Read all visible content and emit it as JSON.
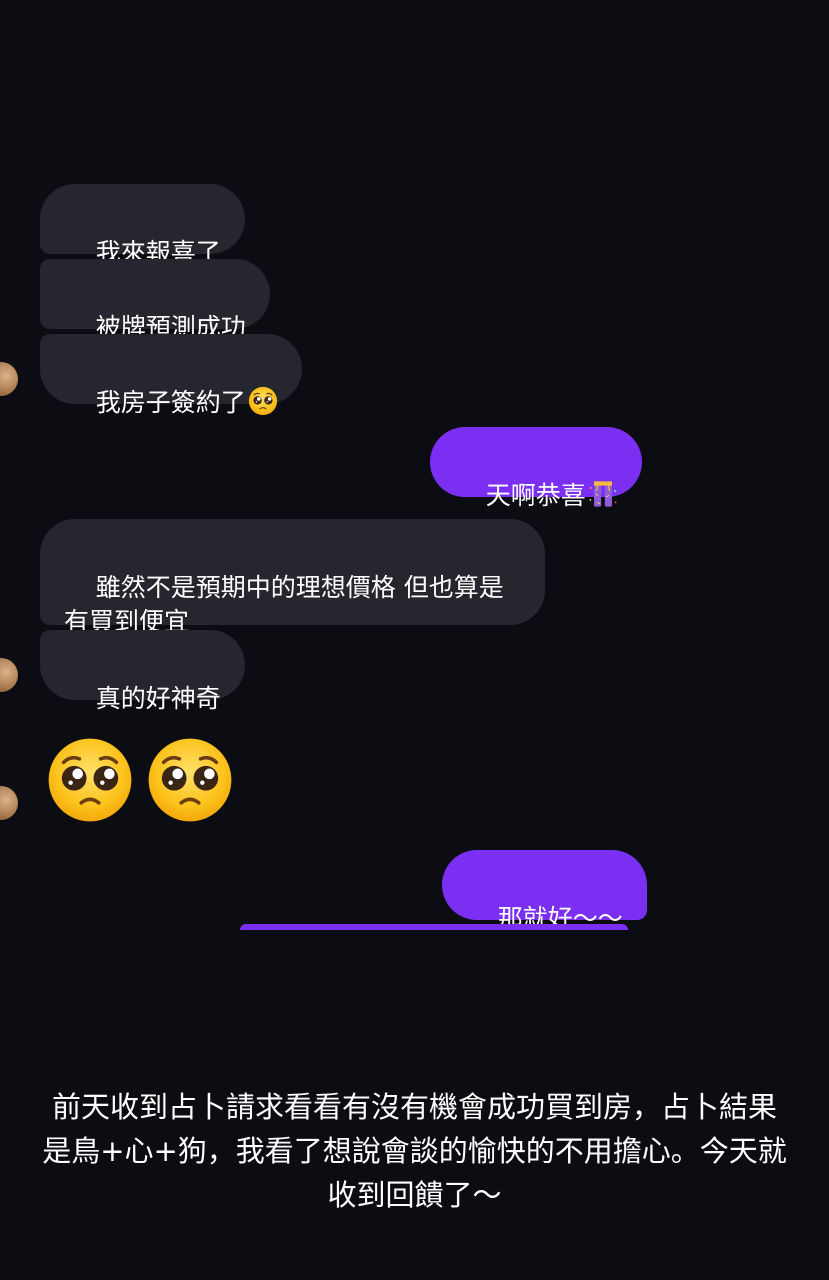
{
  "chat": {
    "messages": [
      {
        "direction": "in",
        "text": "我來報喜了"
      },
      {
        "direction": "in",
        "text": "被牌預測成功"
      },
      {
        "direction": "in",
        "text": "我房子簽約了",
        "emoji": "pleading-face-emoji"
      },
      {
        "direction": "out",
        "text": "天啊恭喜",
        "emoji": "party-popper-emoji"
      },
      {
        "direction": "in",
        "text": "雖然不是預期中的理想價格 但也算是\n有買到便宜"
      },
      {
        "direction": "in",
        "text": "真的好神奇"
      },
      {
        "direction": "in",
        "type": "big-emoji",
        "emoji": [
          "pleading-face-emoji",
          "pleading-face-emoji"
        ]
      },
      {
        "direction": "out",
        "text": "那就好～～"
      }
    ],
    "colors": {
      "background": "#0c0d12",
      "incoming_bubble": "#26272e",
      "outgoing_bubble": "#7b2ff2",
      "text": "#ffffff"
    }
  },
  "caption": {
    "text": "前天收到占卜請求看看有沒有機會成功買到房，占卜結果是鳥+心+狗，我看了想說會談的愉快的不用擔心。今天就收到回饋了～"
  }
}
